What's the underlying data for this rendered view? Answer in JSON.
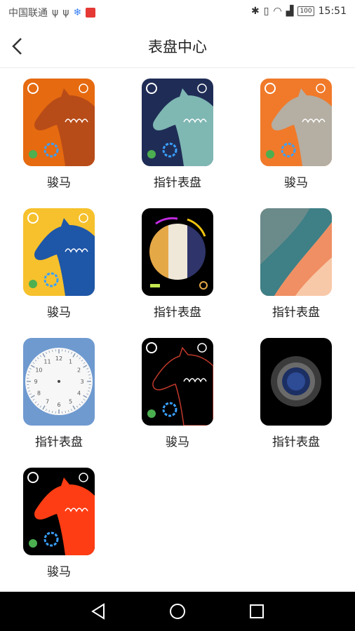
{
  "status_bar": {
    "carrier": "中国联通",
    "battery": "100",
    "time": "15:51"
  },
  "header": {
    "title": "表盘中心"
  },
  "faces": [
    {
      "label": "骏马",
      "style": "horse",
      "bg": "#e66a10",
      "horse": "#b84c18"
    },
    {
      "label": "指针表盘",
      "style": "horse",
      "bg": "#1f2d56",
      "horse": "#7fb7b3"
    },
    {
      "label": "骏马",
      "style": "horse",
      "bg": "#f07a2a",
      "horse": "#b5aea3"
    },
    {
      "label": "骏马",
      "style": "horse",
      "bg": "#f6c12c",
      "horse": "#1e56a8"
    },
    {
      "label": "指针表盘",
      "style": "stripes",
      "bg": "#000000"
    },
    {
      "label": "指针表盘",
      "style": "waves",
      "bg": "#f8c9a8"
    },
    {
      "label": "指针表盘",
      "style": "analog",
      "bg": "#6f9ad0"
    },
    {
      "label": "骏马",
      "style": "horse-outline",
      "bg": "#000000",
      "horse": "#c0392b"
    },
    {
      "label": "指针表盘",
      "style": "lens",
      "bg": "#000000"
    },
    {
      "label": "骏马",
      "style": "horse",
      "bg": "#000000",
      "horse": "#ff3d14"
    }
  ],
  "icons": {
    "back": "chevron-left-icon",
    "nav_back": "triangle-back-icon",
    "nav_home": "circle-home-icon",
    "nav_recent": "square-recent-icon"
  }
}
